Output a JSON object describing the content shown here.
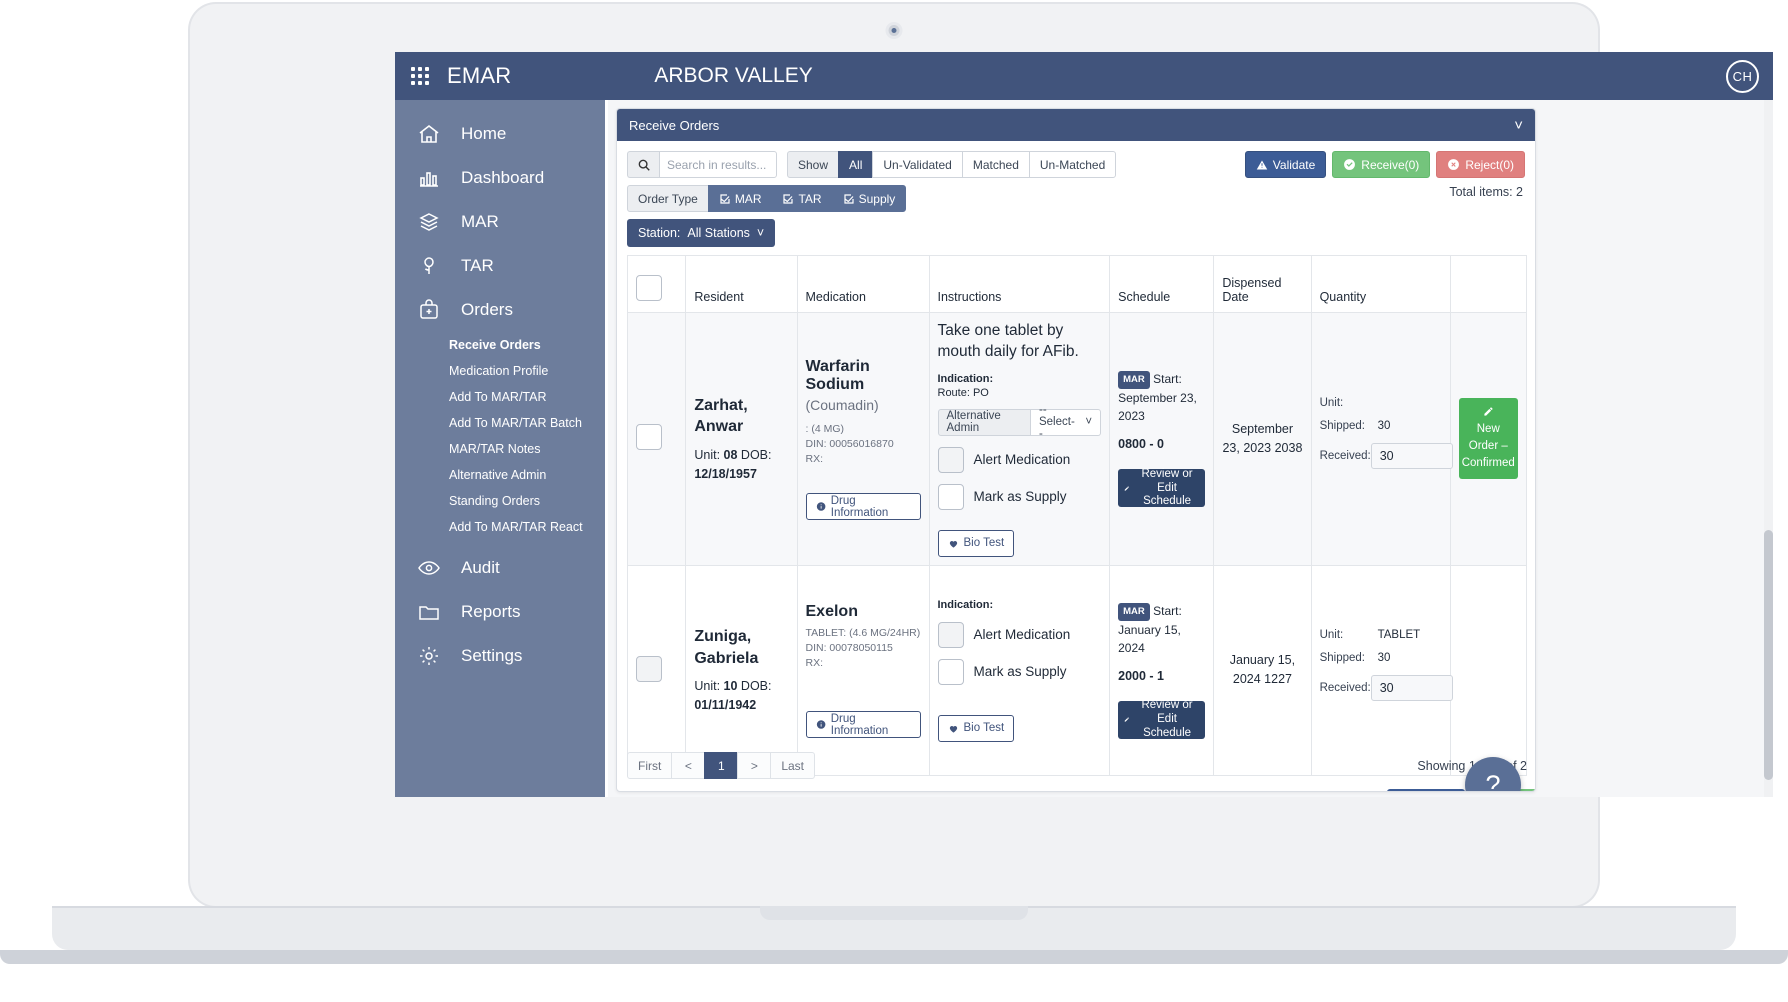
{
  "topbar": {
    "menu_icon": "grid-menu-icon",
    "brand": "EMAR",
    "facility": "ARBOR VALLEY",
    "avatar_initials": "CH"
  },
  "sidebar": {
    "items": [
      {
        "label": "Home",
        "icon": "home-icon"
      },
      {
        "label": "Dashboard",
        "icon": "chart-bars-icon"
      },
      {
        "label": "MAR",
        "icon": "layers-icon"
      },
      {
        "label": "TAR",
        "icon": "flower-icon"
      },
      {
        "label": "Orders",
        "icon": "bag-plus-icon"
      }
    ],
    "orders_subitems": [
      {
        "label": "Receive Orders",
        "active": true
      },
      {
        "label": "Medication Profile",
        "active": false
      },
      {
        "label": "Add To MAR/TAR",
        "active": false
      },
      {
        "label": "Add To MAR/TAR Batch",
        "active": false
      },
      {
        "label": "MAR/TAR Notes",
        "active": false
      },
      {
        "label": "Alternative Admin",
        "active": false
      },
      {
        "label": "Standing Orders",
        "active": false
      },
      {
        "label": "Add To MAR/TAR React",
        "active": false
      }
    ],
    "items_bottom": [
      {
        "label": "Audit",
        "icon": "eye-icon"
      },
      {
        "label": "Reports",
        "icon": "folder-icon"
      },
      {
        "label": "Settings",
        "icon": "gear-icon"
      }
    ]
  },
  "card": {
    "title": "Receive Orders",
    "collapse_icon": "chevron-down-icon"
  },
  "toolbar": {
    "search_icon": "search-icon",
    "search_placeholder": "Search in results...",
    "search_value": "",
    "show_label": "Show",
    "show_options": [
      {
        "label": "All",
        "active": true
      },
      {
        "label": "Un-Validated",
        "active": false
      },
      {
        "label": "Matched",
        "active": false
      },
      {
        "label": "Un-Matched",
        "active": false
      }
    ],
    "order_type_label": "Order Type",
    "order_types": [
      {
        "label": "MAR",
        "checked": true
      },
      {
        "label": "TAR",
        "checked": true
      },
      {
        "label": "Supply",
        "checked": true
      }
    ],
    "station_label": "Station:",
    "station_value": "All Stations",
    "validate_label": "Validate",
    "receive_label": "Receive(0)",
    "reject_label": "Reject(0)",
    "total_items": "Total items: 2"
  },
  "table": {
    "headers": [
      "",
      "Resident",
      "Medication",
      "Instructions",
      "Schedule",
      "Dispensed Date",
      "Quantity",
      ""
    ],
    "rows": [
      {
        "resident": {
          "name": "Zarhat, Anwar",
          "unit_label": "Unit:",
          "unit_value": "08",
          "dob_label": "DOB:",
          "dob_value": "12/18/1957"
        },
        "medication": {
          "name": "Warfarin Sodium",
          "brand": "(Coumadin)",
          "strength": ": (4 MG)",
          "din": "DIN: 00056016870",
          "rx": "RX:",
          "drug_info_label": "Drug Information"
        },
        "instructions": {
          "text": "Take one tablet by mouth daily for AFib.",
          "indication_label": "Indication:",
          "route": "Route: PO",
          "alt_admin_label": "Alternative Admin",
          "alt_admin_value": "--Select--",
          "alert_label": "Alert Medication",
          "supply_label": "Mark as Supply",
          "bio_test_label": "Bio Test"
        },
        "schedule": {
          "badge": "MAR",
          "start": "Start: September 23, 2023",
          "time": "0800 - 0",
          "edit_label": "Review or Edit Schedule"
        },
        "dispensed_date": "September 23, 2023 2038",
        "quantity": {
          "unit_label": "Unit:",
          "unit_value": "",
          "shipped_label": "Shipped:",
          "shipped_value": "30",
          "received_label": "Received:",
          "received_value": "30"
        },
        "status": "New Order – Confirmed"
      },
      {
        "resident": {
          "name": "Zuniga, Gabriela",
          "unit_label": "Unit:",
          "unit_value": "10",
          "dob_label": "DOB:",
          "dob_value": "01/11/1942"
        },
        "medication": {
          "name": "Exelon",
          "brand": "",
          "strength": "TABLET: (4.6 MG/24HR)",
          "din": "DIN: 00078050115",
          "rx": "RX:",
          "drug_info_label": "Drug Information"
        },
        "instructions": {
          "text": "",
          "indication_label": "Indication:",
          "route": "",
          "alt_admin_label": "",
          "alt_admin_value": "",
          "alert_label": "Alert Medication",
          "supply_label": "Mark as Supply",
          "bio_test_label": "Bio Test"
        },
        "schedule": {
          "badge": "MAR",
          "start": "Start: January 15, 2024",
          "time": "2000 - 1",
          "edit_label": "Review or Edit Schedule"
        },
        "dispensed_date": "January 15, 2024 1227",
        "quantity": {
          "unit_label": "Unit:",
          "unit_value": "TABLET",
          "shipped_label": "Shipped:",
          "shipped_value": "30",
          "received_label": "Received:",
          "received_value": "30"
        },
        "status": ""
      }
    ]
  },
  "pager": {
    "first": "First",
    "prev": "<",
    "current": "1",
    "next": ">",
    "last": "Last",
    "showing": "Showing 1 To 2 of 2"
  },
  "help": {
    "label": "?"
  },
  "colors": {
    "navy": "#41547c",
    "sidebar": "#6d7d9c",
    "green": "#74c47c",
    "status_green": "#49b45a",
    "red": "#e0807f",
    "blue": "#3c5c96"
  }
}
